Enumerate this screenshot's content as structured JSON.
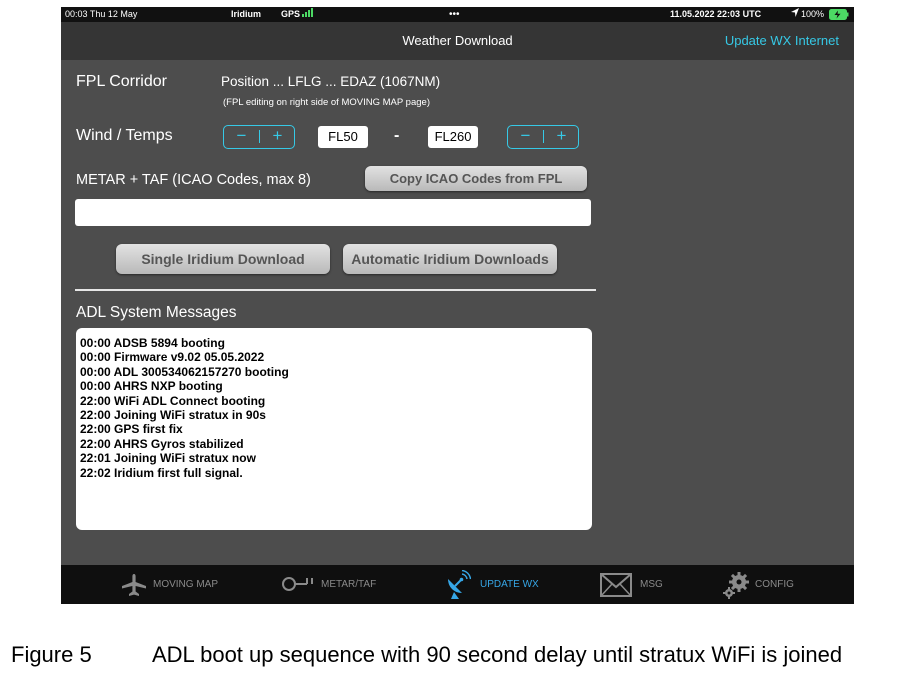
{
  "status_bar": {
    "time_date": "00:03  Thu 12 May",
    "network": "Iridium",
    "gps": "GPS",
    "dots": "•••",
    "utc": "11.05.2022  22:03 UTC",
    "battery": "100%"
  },
  "nav": {
    "title": "Weather Download",
    "right_action": "Update WX Internet"
  },
  "fpl": {
    "label": "FPL Corridor",
    "route": "Position ... LFLG ... EDAZ (1067NM)",
    "note": "(FPL editing on right side of MOVING MAP page)"
  },
  "wind": {
    "label": "Wind / Temps",
    "minus": "−",
    "plus": "+",
    "from_level": "FL50",
    "dash": "-",
    "to_level": "FL260"
  },
  "metar": {
    "label": "METAR + TAF (ICAO Codes, max 8)",
    "copy_button": "Copy ICAO Codes from FPL",
    "input_value": ""
  },
  "downloads": {
    "single": "Single Iridium Download",
    "automatic": "Automatic Iridium Downloads"
  },
  "messages": {
    "title": "ADL System Messages",
    "lines": [
      "00:00 ADSB 5894 booting",
      "00:00 Firmware v9.02 05.05.2022",
      "00:00 ADL 300534062157270 booting",
      "00:00 AHRS NXP booting",
      "22:00 WiFi ADL Connect booting",
      "22:00 Joining WiFi stratux in 90s",
      "22:00 GPS first fix",
      "22:00 AHRS Gyros stabilized",
      "22:01 Joining WiFi stratux now",
      "22:02 Iridium first full signal."
    ]
  },
  "tabs": [
    {
      "label": "MOVING MAP",
      "icon": "airplane-icon"
    },
    {
      "label": "METAR/TAF",
      "icon": "windsock-icon"
    },
    {
      "label": "UPDATE WX",
      "icon": "satellite-dish-icon",
      "active": true
    },
    {
      "label": "MSG",
      "icon": "envelope-icon"
    },
    {
      "label": "CONFIG",
      "icon": "gear-icon"
    }
  ],
  "caption": {
    "figure": "Figure 5",
    "text": "ADL boot up sequence with 90 second delay until stratux WiFi is joined"
  },
  "colors": {
    "accent": "#36c9e6",
    "active_tab": "#36a6e6",
    "background": "#4d4d4d",
    "battery": "#4cd964"
  }
}
